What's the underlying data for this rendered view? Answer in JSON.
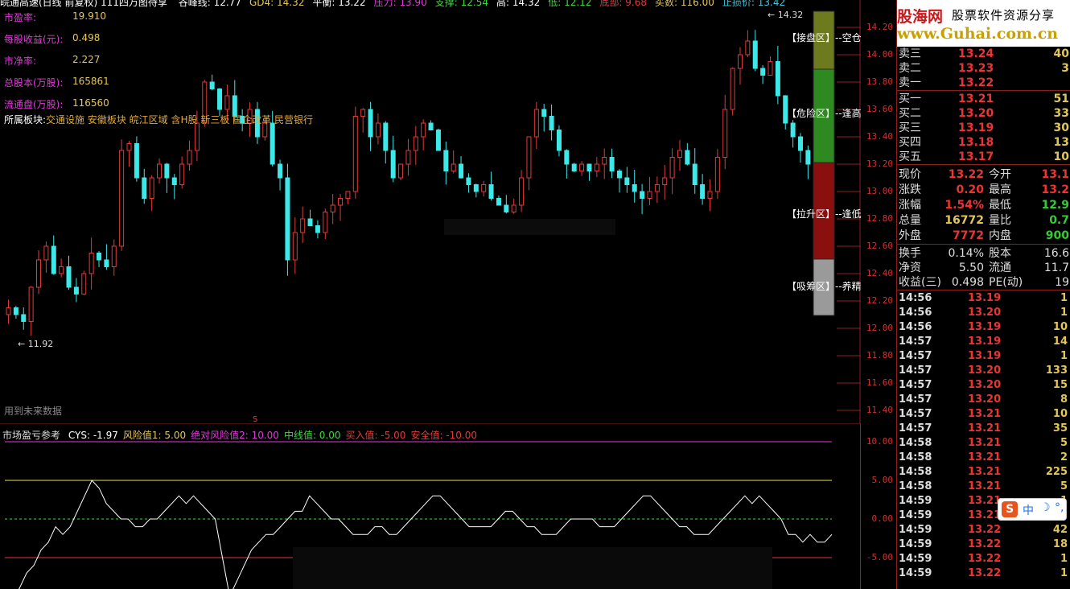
{
  "topbar": {
    "title": "皖通高速(日线 前复权) 111四万图待享",
    "items": [
      {
        "label": "谷峰线: 12.77",
        "color": "#ffffff"
      },
      {
        "label": "GD4: 14.32",
        "color": "#e3c65a"
      },
      {
        "label": "平衡: 13.22",
        "color": "#ffffff"
      },
      {
        "label": "压力: 13.90",
        "color": "#e03bd8"
      },
      {
        "label": "支撑: 12.54",
        "color": "#40d840"
      },
      {
        "label": "高: 14.32",
        "color": "#ffffff"
      },
      {
        "label": "低: 12.12",
        "color": "#40d840"
      },
      {
        "label": "底部: 9.68",
        "color": "#e03b3b"
      },
      {
        "label": "买数: 116.00",
        "color": "#e3c65a"
      },
      {
        "label": "止损价: 13.42",
        "color": "#40c8e0"
      }
    ]
  },
  "fundamentals": [
    {
      "label": "市盈率:",
      "value": "19.910"
    },
    {
      "label": "每股收益(元):",
      "value": "0.498"
    },
    {
      "label": "市净率:",
      "value": "2.227"
    },
    {
      "label": "总股本(万股):",
      "value": "165861"
    },
    {
      "label": "流通盘(万股):",
      "value": "116560"
    }
  ],
  "sector": {
    "label": "所属板块:",
    "value": "交通设施 安徽板块 皖江区域 含H股 新三板 国企改革 民营银行"
  },
  "future_note": "用到未来数据",
  "marker_s": "S",
  "price_axis": [
    "14.20",
    "14.00",
    "13.80",
    "13.60",
    "13.40",
    "13.20",
    "13.00",
    "12.80",
    "12.60",
    "12.40",
    "12.20",
    "12.00",
    "11.80",
    "11.60",
    "11.40"
  ],
  "price_annotations": {
    "high": "14.32",
    "low": "11.92"
  },
  "zones": [
    {
      "label": "【接盘区】--空仓",
      "color": "#6e7a1e"
    },
    {
      "label": "【危险区】--逢高",
      "color": "#2e8a20"
    },
    {
      "label": "【拉升区】--逢低",
      "color": "#8a1010"
    },
    {
      "label": "【吸筹区】--养精",
      "color": "#9a9a9a"
    }
  ],
  "oscillator": {
    "title": "市场盈亏参考",
    "items": [
      {
        "label": "CYS: -1.97",
        "color": "#ffffff"
      },
      {
        "label": "风险值1: 5.00",
        "color": "#e3c65a"
      },
      {
        "label": "绝对风险值2: 10.00",
        "color": "#e03bd8"
      },
      {
        "label": "中线值: 0.00",
        "color": "#40d840"
      },
      {
        "label": "买入值: -5.00",
        "color": "#e03b3b"
      },
      {
        "label": "安全值: -10.00",
        "color": "#e03b3b"
      }
    ],
    "axis": [
      "10.00",
      "5.00",
      "0.00",
      "-5.00"
    ]
  },
  "logo": {
    "name": "股海网",
    "slogan": "股票软件资源分享",
    "url": "www.Guhai.com.cn"
  },
  "orderbook": {
    "asks": [
      {
        "label": "卖三",
        "price": "13.24",
        "vol": "40"
      },
      {
        "label": "卖二",
        "price": "13.23",
        "vol": "3"
      },
      {
        "label": "卖一",
        "price": "13.22",
        "vol": ""
      }
    ],
    "bids": [
      {
        "label": "买一",
        "price": "13.21",
        "vol": "51"
      },
      {
        "label": "买二",
        "price": "13.20",
        "vol": "33"
      },
      {
        "label": "买三",
        "price": "13.19",
        "vol": "30"
      },
      {
        "label": "买四",
        "price": "13.18",
        "vol": "13"
      },
      {
        "label": "买五",
        "price": "13.17",
        "vol": "10"
      }
    ]
  },
  "quote": [
    {
      "l1": "现价",
      "v1": "13.22",
      "l2": "今开",
      "v2": "13.1",
      "c1": "#e33",
      "c2": "#e33"
    },
    {
      "l1": "涨跌",
      "v1": "0.20",
      "l2": "最高",
      "v2": "13.2",
      "c1": "#e33",
      "c2": "#e33"
    },
    {
      "l1": "涨幅",
      "v1": "1.54%",
      "l2": "最低",
      "v2": "12.9",
      "c1": "#e33",
      "c2": "#3c3"
    },
    {
      "l1": "总量",
      "v1": "16772",
      "l2": "量比",
      "v2": "0.7",
      "c1": "#e3c65a",
      "c2": "#3c3"
    },
    {
      "l1": "外盘",
      "v1": "7772",
      "l2": "内盘",
      "v2": "900",
      "c1": "#e33",
      "c2": "#3c3"
    }
  ],
  "stats": [
    {
      "l1": "换手",
      "v1": "0.14%",
      "l2": "股本",
      "v2": "16.6"
    },
    {
      "l1": "净资",
      "v1": "5.50",
      "l2": "流通",
      "v2": "11.7"
    },
    {
      "l1": "收益(三)",
      "v1": "0.498",
      "l2": "PE(动)",
      "v2": "19"
    }
  ],
  "ticks": [
    {
      "time": "14:56",
      "price": "13.19",
      "vol": "1"
    },
    {
      "time": "14:56",
      "price": "13.20",
      "vol": "1"
    },
    {
      "time": "14:56",
      "price": "13.19",
      "vol": "10"
    },
    {
      "time": "14:57",
      "price": "13.19",
      "vol": "14"
    },
    {
      "time": "14:57",
      "price": "13.19",
      "vol": "1"
    },
    {
      "time": "14:57",
      "price": "13.20",
      "vol": "133"
    },
    {
      "time": "14:57",
      "price": "13.20",
      "vol": "15"
    },
    {
      "time": "14:57",
      "price": "13.20",
      "vol": "8"
    },
    {
      "time": "14:57",
      "price": "13.21",
      "vol": "10"
    },
    {
      "time": "14:57",
      "price": "13.21",
      "vol": "35"
    },
    {
      "time": "14:58",
      "price": "13.21",
      "vol": "5"
    },
    {
      "time": "14:58",
      "price": "13.21",
      "vol": "2"
    },
    {
      "time": "14:58",
      "price": "13.21",
      "vol": "225"
    },
    {
      "time": "14:58",
      "price": "13.21",
      "vol": "5"
    },
    {
      "time": "14:59",
      "price": "13.21",
      "vol": "1"
    },
    {
      "time": "14:59",
      "price": "13.21",
      "vol": "5"
    },
    {
      "time": "14:59",
      "price": "13.22",
      "vol": "42"
    },
    {
      "time": "14:59",
      "price": "13.22",
      "vol": "18"
    },
    {
      "time": "14:59",
      "price": "13.22",
      "vol": "1"
    },
    {
      "time": "14:59",
      "price": "13.22",
      "vol": "1"
    }
  ],
  "ime": {
    "label": "中"
  }
}
